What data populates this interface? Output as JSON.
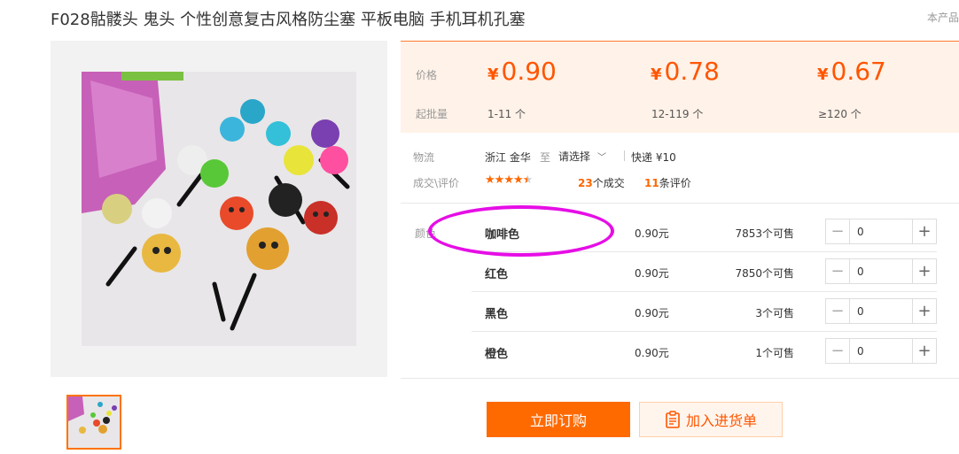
{
  "title": "F028骷髅头 鬼头 个性创意复古风格防尘塞 平板电脑 手机耳机孔塞",
  "corner_note": "本产品",
  "price_panel": {
    "price_label": "价格",
    "moq_label": "起批量",
    "currency": "¥",
    "tiers": [
      {
        "price": "0.90",
        "range": "1-11 个"
      },
      {
        "price": "0.78",
        "range": "12-119 个"
      },
      {
        "price": "0.67",
        "range": "≥120 个"
      }
    ]
  },
  "logistics": {
    "label": "物流",
    "origin": "浙江 金华",
    "to": "至",
    "destination": "请选择",
    "express": "快递 ¥10"
  },
  "reviews": {
    "label": "成交\\评价",
    "rating": 4.5,
    "deals_count": "23",
    "deals_text": "个成交",
    "review_count": "11",
    "review_text": "条评价"
  },
  "color_label": "颜色",
  "variants": [
    {
      "color": "咖啡色",
      "price": "0.90元",
      "stock": "7853个可售",
      "qty": "0"
    },
    {
      "color": "红色",
      "price": "0.90元",
      "stock": "7850个可售",
      "qty": "0"
    },
    {
      "color": "黑色",
      "price": "0.90元",
      "stock": "3个可售",
      "qty": "0"
    },
    {
      "color": "橙色",
      "price": "0.90元",
      "stock": "1个可售",
      "qty": "0"
    }
  ],
  "buttons": {
    "buy": "立即订购",
    "cart": "加入进货单"
  },
  "icons": {
    "minus": "minus-icon",
    "plus": "plus-icon",
    "cart": "clipboard-icon",
    "chevron": "chevron-down-icon"
  },
  "colors": {
    "accent": "#ff6a00",
    "price": "#ff5500",
    "highlight_ellipse": "#e60ee6"
  }
}
